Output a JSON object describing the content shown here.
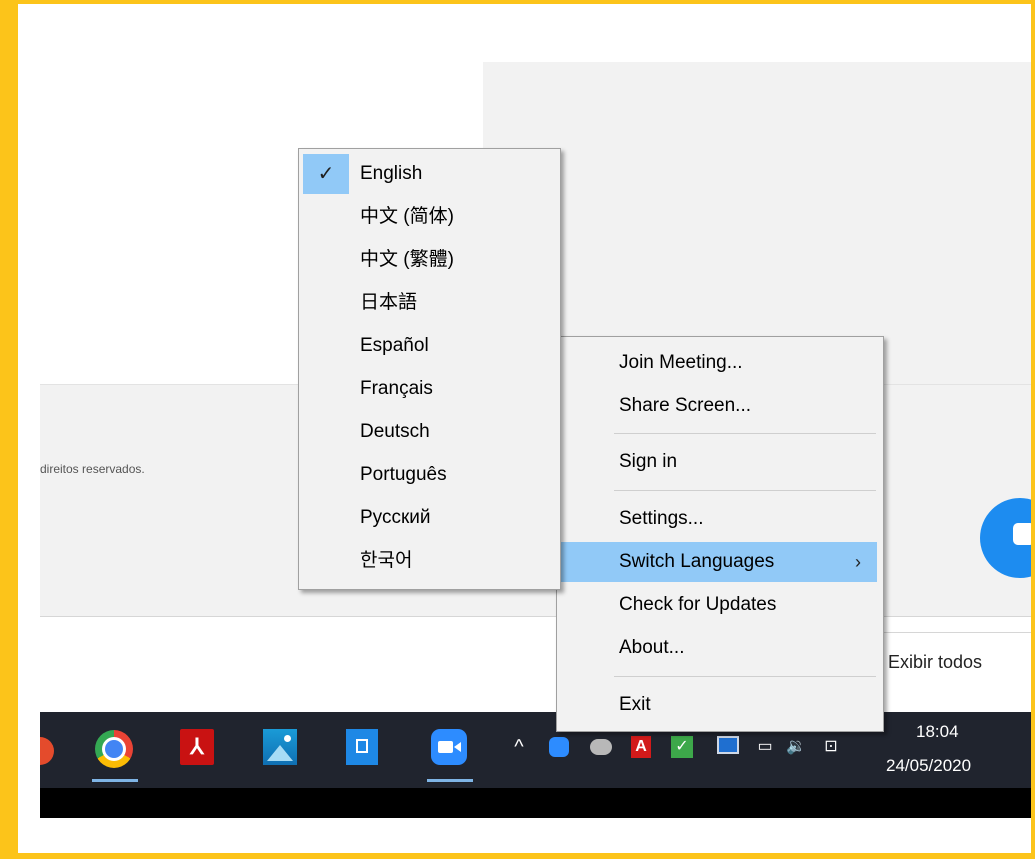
{
  "background": {
    "copyright_fragment": "direitos reservados.",
    "downloads_show_all": "Exibir todos"
  },
  "context_menu": {
    "items": [
      {
        "label": "Join Meeting..."
      },
      {
        "label": "Share Screen..."
      },
      {
        "label": "Sign in"
      },
      {
        "label": "Settings..."
      },
      {
        "label": "Switch Languages",
        "highlighted": true,
        "arrow": "›"
      },
      {
        "label": "Check for Updates"
      },
      {
        "label": "About..."
      },
      {
        "label": "Exit"
      }
    ]
  },
  "language_submenu": {
    "check_mark": "✓",
    "selected": "English",
    "items": [
      {
        "label": "English"
      },
      {
        "label": "中文 (简体)"
      },
      {
        "label": "中文 (繁體)"
      },
      {
        "label": "日本語"
      },
      {
        "label": "Español"
      },
      {
        "label": "Français"
      },
      {
        "label": "Deutsch"
      },
      {
        "label": "Português"
      },
      {
        "label": "Русский"
      },
      {
        "label": "한국어"
      }
    ]
  },
  "taskbar": {
    "pinned_apps": [
      "chrome-icon",
      "acrobat-icon",
      "photos-icon",
      "store-icon",
      "zoom-icon"
    ],
    "acrobat_glyph": "⅄",
    "tray": {
      "overflow_arrow": "^",
      "acrobat_letter": "A",
      "check_glyph": "✓",
      "battery_glyph": "▭",
      "volume_glyph": "🔉",
      "network_glyph": "⊡"
    },
    "clock": {
      "time": "18:04",
      "date": "24/05/2020"
    }
  },
  "colors": {
    "frame_border": "#fcc41a",
    "menu_highlight": "#91c9f7",
    "taskbar": "#20242e",
    "zoom_blue": "#2d8cff"
  }
}
